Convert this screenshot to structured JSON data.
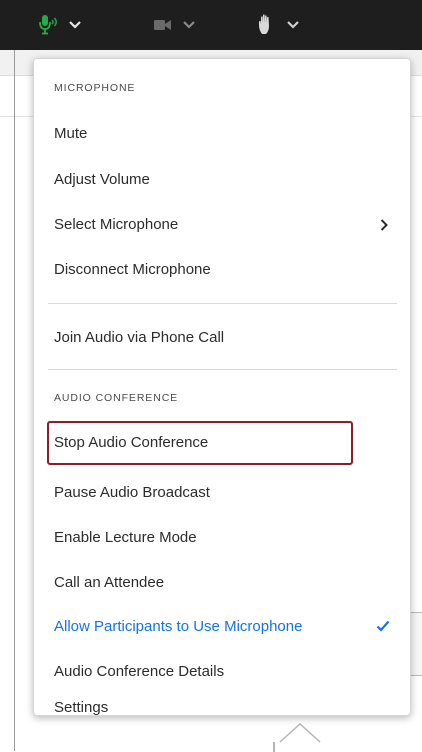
{
  "toolbar": {
    "mic_icon": "microphone-icon",
    "camera_icon": "camera-icon",
    "hand_icon": "raise-hand-icon",
    "chevron_icon": "chevron-down-icon",
    "mic_color": "#2ba84a"
  },
  "menu": {
    "microphone_header": "MICROPHONE",
    "audio_conference_header": "AUDIO CONFERENCE",
    "items": {
      "mute": "Mute",
      "adjust_volume": "Adjust Volume",
      "select_microphone": "Select Microphone",
      "disconnect_microphone": "Disconnect Microphone",
      "join_audio_phone": "Join Audio via Phone Call",
      "stop_audio_conference": "Stop Audio Conference",
      "pause_audio_broadcast": "Pause Audio Broadcast",
      "enable_lecture_mode": "Enable Lecture Mode",
      "call_attendee": "Call an Attendee",
      "allow_participants_mic": "Allow Participants to Use Microphone",
      "audio_conference_details": "Audio Conference Details",
      "settings": "Settings"
    },
    "allow_participants_checked": true,
    "selected_color": "#1473e6",
    "highlight_color": "#8b1e2a",
    "submenu_icon": "chevron-right-icon",
    "check_icon": "checkmark-icon"
  }
}
